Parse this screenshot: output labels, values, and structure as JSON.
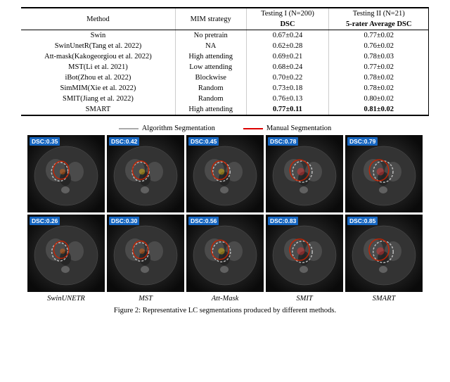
{
  "table": {
    "col_headers": [
      "Method",
      "MIM strategy",
      "Testing I (N=200)",
      "Testing II (N=21)"
    ],
    "sub_headers": [
      "",
      "",
      "DSC",
      "5-rater Average DSC"
    ],
    "rows": [
      {
        "method": "Swin",
        "mim": "No pretrain",
        "dsc1": "0.67±0.24",
        "dsc2": "0.77±0.02",
        "bold": false
      },
      {
        "method": "SwinUnetR(Tang et al. 2022)",
        "mim": "NA",
        "dsc1": "0.62±0.28",
        "dsc2": "0.76±0.02",
        "bold": false
      },
      {
        "method": "Att-mask(Kakogeorgiou et al. 2022)",
        "mim": "High attending",
        "dsc1": "0.69±0.21",
        "dsc2": "0.78±0.03",
        "bold": false
      },
      {
        "method": "MST(Li et al. 2021)",
        "mim": "Low attending",
        "dsc1": "0.68±0.24",
        "dsc2": "0.77±0.02",
        "bold": false
      },
      {
        "method": "iBot(Zhou et al. 2022)",
        "mim": "Blockwise",
        "dsc1": "0.70±0.22",
        "dsc2": "0.78±0.02",
        "bold": false
      },
      {
        "method": "SimMIM(Xie et al. 2022)",
        "mim": "Random",
        "dsc1": "0.73±0.18",
        "dsc2": "0.78±0.02",
        "bold": false
      },
      {
        "method": "SMIT(Jiang et al. 2022)",
        "mim": "Random",
        "dsc1": "0.76±0.13",
        "dsc2": "0.80±0.02",
        "bold": false
      },
      {
        "method": "SMART",
        "mim": "High attending",
        "dsc1": "0.77±0.11",
        "dsc2": "0.81±0.02",
        "bold": true
      }
    ]
  },
  "legend": {
    "algo": "Algorithm Segmentation",
    "manual": "Manual Segmentation"
  },
  "top_row_images": [
    {
      "dsc": "DSC:0.35"
    },
    {
      "dsc": "DSC:0.42"
    },
    {
      "dsc": "DSC:0.45"
    },
    {
      "dsc": "DSC:0.78"
    },
    {
      "dsc": "DSC:0.79"
    }
  ],
  "bottom_row_images": [
    {
      "dsc": "DSC:0.26"
    },
    {
      "dsc": "DSC:0.30"
    },
    {
      "dsc": "DSC:0.56"
    },
    {
      "dsc": "DSC:0.83"
    },
    {
      "dsc": "DSC:0.85"
    }
  ],
  "method_labels": [
    "SwinUNETR",
    "MST",
    "Att-Mask",
    "SMIT",
    "SMART"
  ],
  "caption": "Figure 2: Representative LC segmentations produced by different methods."
}
